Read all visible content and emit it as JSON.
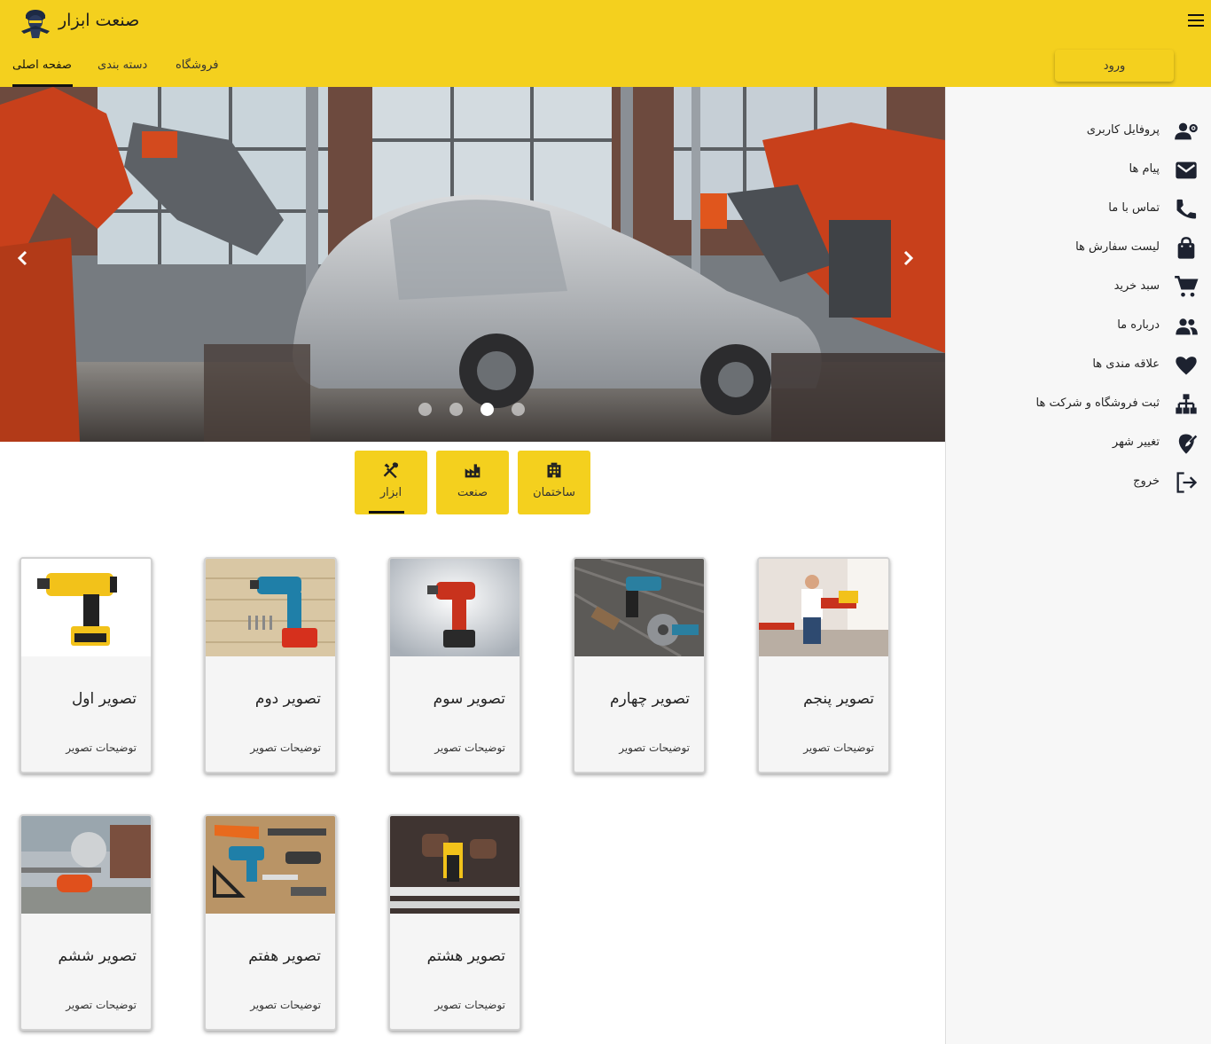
{
  "header": {
    "brand": "صنعت ابزار",
    "login_label": "ورود",
    "tabs": [
      {
        "label": "صفحه اصلی",
        "active": true
      },
      {
        "label": "دسته بندی",
        "active": false
      },
      {
        "label": "فروشگاه",
        "active": false
      }
    ],
    "color": "#f4d01e"
  },
  "carousel": {
    "slide_count": 4,
    "active_index": 2,
    "prev_icon": "chevron-left-icon",
    "next_icon": "chevron-right-icon"
  },
  "categories": [
    {
      "label": "ابزار",
      "icon": "tools-icon",
      "active": true
    },
    {
      "label": "صنعت",
      "icon": "factory-icon",
      "active": false
    },
    {
      "label": "ساختمان",
      "icon": "building-icon",
      "active": false
    }
  ],
  "cards": [
    {
      "title": "تصویر اول",
      "description": "توضیحات تصویر"
    },
    {
      "title": "تصویر دوم",
      "description": "توضیحات تصویر"
    },
    {
      "title": "تصویر سوم",
      "description": "توضیحات تصویر"
    },
    {
      "title": "تصویر چهارم",
      "description": "توضیحات تصویر"
    },
    {
      "title": "تصویر پنجم",
      "description": "توضیحات تصویر"
    },
    {
      "title": "تصویر ششم",
      "description": "توضیحات تصویر"
    },
    {
      "title": "تصویر هفتم",
      "description": "توضیحات تصویر"
    },
    {
      "title": "تصویر هشتم",
      "description": "توضیحات تصویر"
    }
  ],
  "sidebar": {
    "items": [
      {
        "label": "پروفایل کاربری",
        "icon": "user-settings-icon"
      },
      {
        "label": "پیام ها",
        "icon": "mail-icon"
      },
      {
        "label": "تماس با ما",
        "icon": "phone-icon"
      },
      {
        "label": "لیست سفارش ها",
        "icon": "shopping-bag-icon"
      },
      {
        "label": "سبد خرید",
        "icon": "cart-icon"
      },
      {
        "label": "درباره ما",
        "icon": "people-icon"
      },
      {
        "label": "علاقه مندی ها",
        "icon": "heart-icon"
      },
      {
        "label": "ثبت فروشگاه و شرکت ها",
        "icon": "sitemap-icon"
      },
      {
        "label": "تغییر شهر",
        "icon": "location-edit-icon"
      },
      {
        "label": "خروج",
        "icon": "logout-icon"
      }
    ]
  }
}
